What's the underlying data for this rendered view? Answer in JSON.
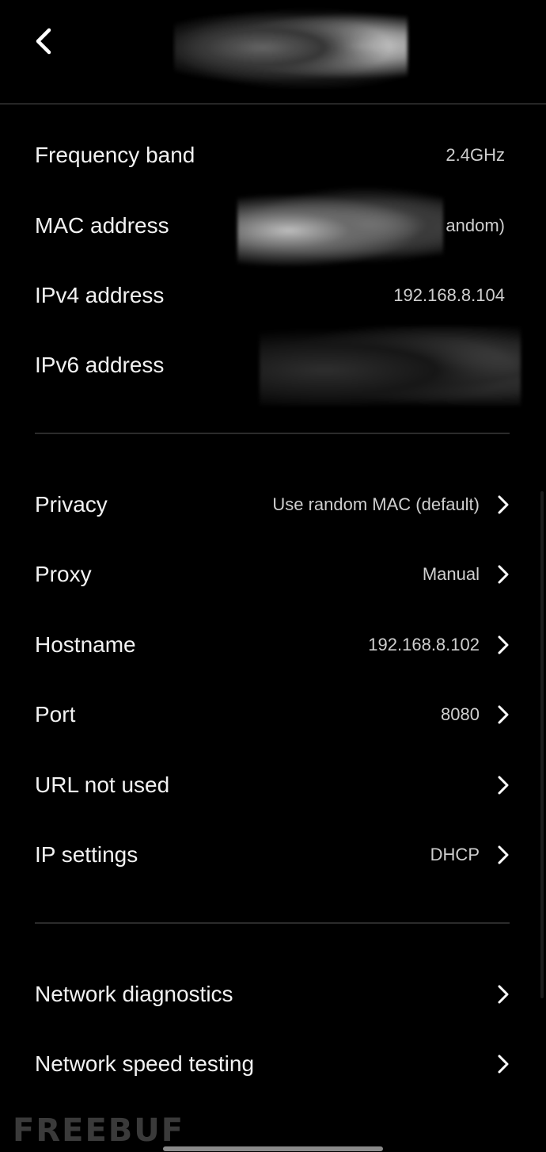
{
  "header": {
    "back_icon": "chevron-left-icon",
    "title": ""
  },
  "info": [
    {
      "label": "Frequency band",
      "value": "2.4GHz"
    },
    {
      "label": "MAC address",
      "value": "andom)"
    },
    {
      "label": "IPv4 address",
      "value": "192.168.8.104"
    },
    {
      "label": "IPv6 address",
      "value": ""
    }
  ],
  "settings": [
    {
      "label": "Privacy",
      "value": "Use random MAC (default)"
    },
    {
      "label": "Proxy",
      "value": "Manual"
    },
    {
      "label": "Hostname",
      "value": "192.168.8.102"
    },
    {
      "label": "Port",
      "value": "8080"
    },
    {
      "label": "URL not used",
      "value": ""
    },
    {
      "label": "IP settings",
      "value": "DHCP"
    }
  ],
  "tools": [
    {
      "label": "Network diagnostics"
    },
    {
      "label": "Network speed testing"
    }
  ],
  "watermark": "FREEBUF",
  "colors": {
    "background": "#000000",
    "text": "#f2f2f2",
    "secondary_text": "#cfcfcf",
    "divider": "#2b2b2b"
  }
}
